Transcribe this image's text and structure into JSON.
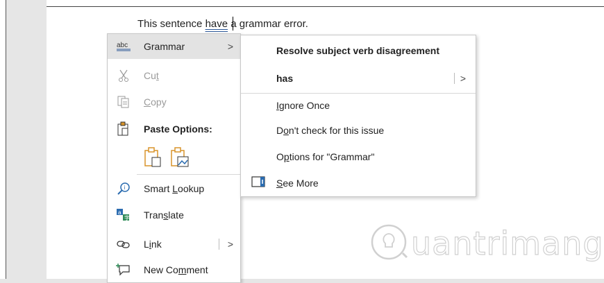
{
  "document": {
    "text_before": "This sentence ",
    "error_word": "have",
    "text_after": " a grammar error."
  },
  "context_menu": {
    "items": [
      {
        "label": "Grammar",
        "icon": "abc-icon"
      },
      {
        "label_pre": "Cu",
        "label_acc": "t",
        "label_post": "",
        "icon": "scissors-icon"
      },
      {
        "label_pre": "",
        "label_acc": "C",
        "label_post": "opy",
        "icon": "copy-icon"
      },
      {
        "label": "Paste Options:",
        "icon": "clipboard-icon"
      },
      {
        "label_pre": "Smart ",
        "label_acc": "L",
        "label_post": "ookup",
        "icon": "smart-lookup-icon"
      },
      {
        "label_pre": "Tran",
        "label_acc": "s",
        "label_post": "late",
        "icon": "translate-icon"
      },
      {
        "label_pre": "L",
        "label_acc": "i",
        "label_post": "nk",
        "icon": "link-icon"
      },
      {
        "label_pre": "New Co",
        "label_acc": "m",
        "label_post": "ment",
        "icon": "new-comment-icon"
      }
    ],
    "abc_glyph": "abc",
    "arrow": ">"
  },
  "submenu": {
    "title": "Resolve subject verb disagreement",
    "suggestion": "has",
    "ignore_acc": "I",
    "ignore_rest": "gnore Once",
    "dont_pre": "D",
    "dont_acc": "o",
    "dont_rest": "n't check for this issue",
    "options_pre": "O",
    "options_acc": "p",
    "options_rest": "tions for \"Grammar\"",
    "seemore_acc": "S",
    "seemore_rest": "ee More",
    "arrow": ">"
  },
  "watermark": {
    "text": "uantrimang"
  }
}
